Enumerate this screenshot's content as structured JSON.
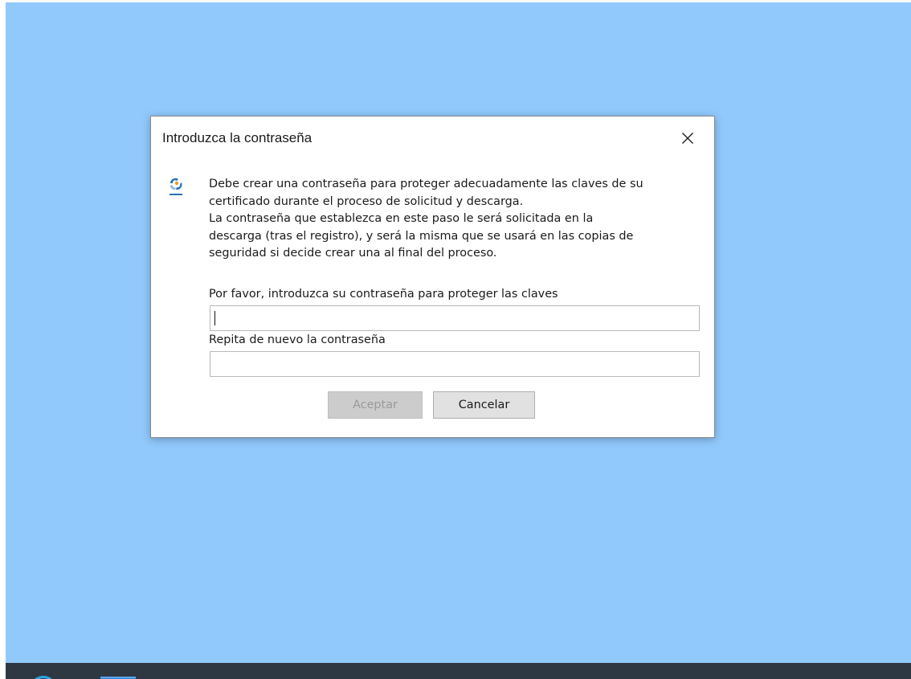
{
  "dialog": {
    "title": "Introduzca la contraseña",
    "message": "Debe crear una contraseña para proteger adecuadamente las claves de su\ncertificado durante el proceso de solicitud y descarga.\nLa contraseña que establezca en este paso le será solicitada en la\ndescarga (tras el registro), y será la misma que se usará en las copias de\nseguridad si decide crear una al final del proceso.",
    "password_label": "Por favor, introduzca su contraseña para proteger las claves",
    "password_value": "",
    "repeat_label": "Repita de nuevo la contraseña",
    "repeat_value": "",
    "accept_label": "Aceptar",
    "cancel_label": "Cancelar",
    "accept_enabled": false,
    "close_icon": "close-icon",
    "app_icon": "certificate-app-icon"
  },
  "colors": {
    "desktop_background": "#91c9fd",
    "taskbar_background": "#2d3842",
    "dialog_background": "#ffffff",
    "button_disabled": "#cccccc",
    "button_default": "#e1e1e1"
  }
}
